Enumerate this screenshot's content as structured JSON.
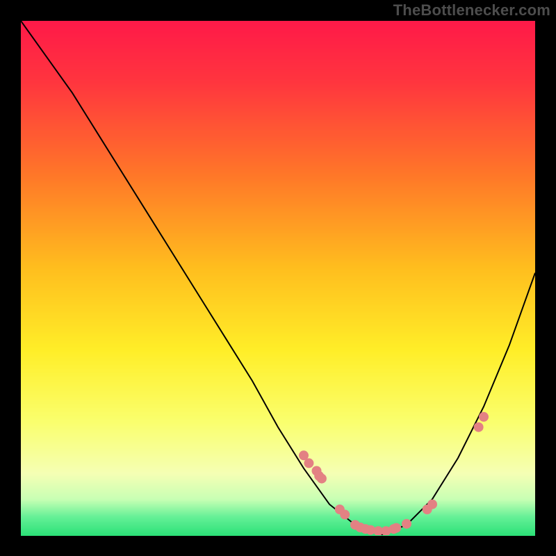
{
  "watermark": "TheBottlenecker.com",
  "chart_data": {
    "type": "line",
    "title": "",
    "xlabel": "",
    "ylabel": "",
    "xlim": [
      0,
      100
    ],
    "ylim": [
      0,
      100
    ],
    "grid": false,
    "legend": false,
    "background_gradient": {
      "top": "#ff1a40",
      "upper_mid": "#ff8c1a",
      "mid": "#ffe61a",
      "lower_mid": "#f7ff66",
      "bottom": "#33e67a"
    },
    "series": [
      {
        "name": "curve",
        "type": "line",
        "x": [
          0,
          5,
          10,
          15,
          20,
          25,
          30,
          35,
          40,
          45,
          50,
          55,
          60,
          65,
          70,
          75,
          80,
          85,
          90,
          95,
          100
        ],
        "y": [
          100,
          93,
          86,
          78,
          70,
          62,
          54,
          46,
          38,
          30,
          21,
          13,
          6,
          2,
          0,
          2,
          7,
          15,
          25,
          37,
          51
        ],
        "stroke": "#000000",
        "stroke_width": 2
      },
      {
        "name": "markers",
        "type": "scatter",
        "x": [
          55,
          56,
          57.5,
          58,
          58.5,
          62,
          63,
          65,
          66,
          67,
          68,
          69.5,
          71,
          72.5,
          73,
          75,
          79,
          80,
          89,
          90
        ],
        "y": [
          15.5,
          14,
          12.5,
          11.5,
          11,
          5,
          4,
          2,
          1.5,
          1.2,
          1,
          0.8,
          0.8,
          1.2,
          1.4,
          2.2,
          5,
          6,
          21,
          23
        ],
        "color": "#e38183",
        "radius": 7
      }
    ]
  }
}
